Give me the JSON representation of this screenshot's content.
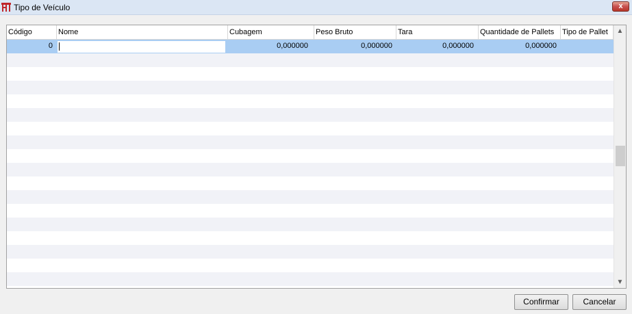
{
  "window": {
    "title": "Tipo de Veículo",
    "close_label": "x"
  },
  "grid": {
    "columns": [
      "Código",
      "Nome",
      "Cubagem",
      "Peso Bruto",
      "Tara",
      "Quantidade de Pallets",
      "Tipo de Pallet"
    ],
    "rows": [
      [
        "0",
        "",
        "0,000000",
        "0,000000",
        "0,000000",
        "0,000000",
        ""
      ]
    ]
  },
  "buttons": {
    "confirm": "Confirmar",
    "cancel": "Cancelar"
  },
  "colors": {
    "selection": "#a9cdf3",
    "alt_row": "#f1f2f7",
    "close": "#c75050"
  },
  "icons": {
    "app": "app-logo-icon",
    "scroll_up": "chevron-up-icon",
    "scroll_down": "chevron-down-icon"
  }
}
